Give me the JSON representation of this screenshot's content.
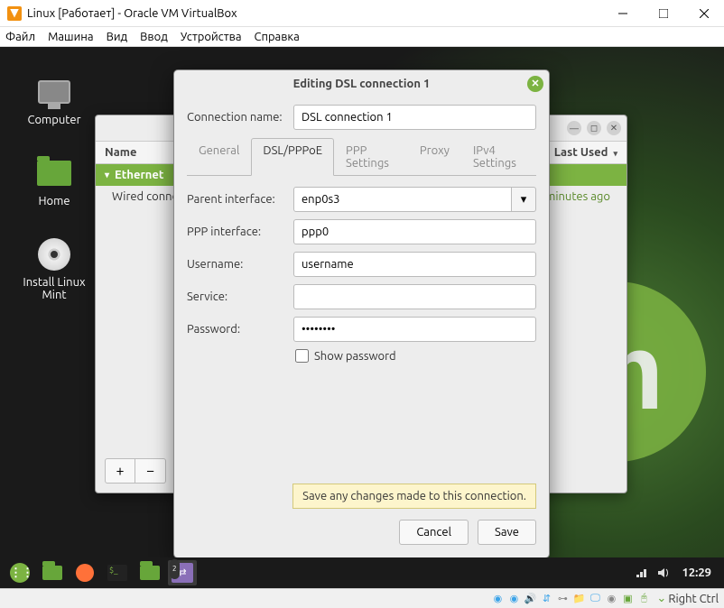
{
  "vb": {
    "title": "Linux [Работает] - Oracle VM VirtualBox",
    "menu": [
      "Файл",
      "Машина",
      "Вид",
      "Ввод",
      "Устройства",
      "Справка"
    ],
    "host_key": "Right Ctrl"
  },
  "desktop": {
    "computer": "Computer",
    "home": "Home",
    "install": "Install Linux Mint"
  },
  "panel": {
    "clock": "12:29"
  },
  "nc": {
    "col_name": "Name",
    "col_last": "Last Used",
    "section": "Ethernet",
    "row_name": "Wired connection",
    "row_last": "minutes ago",
    "add": "+",
    "remove": "−"
  },
  "dialog": {
    "title": "Editing DSL connection 1",
    "conn_name_label": "Connection name:",
    "conn_name": "DSL connection 1",
    "tabs": {
      "general": "General",
      "dsl": "DSL/PPPoE",
      "ppp": "PPP Settings",
      "proxy": "Proxy",
      "ipv4": "IPv4 Settings"
    },
    "fields": {
      "parent_label": "Parent interface:",
      "parent": "enp0s3",
      "pppif_label": "PPP interface:",
      "pppif": "ppp0",
      "user_label": "Username:",
      "user": "username",
      "service_label": "Service:",
      "service": "",
      "pass_label": "Password:",
      "pass": "••••••••",
      "showpass": "Show password"
    },
    "tooltip": "Save any changes made to this connection.",
    "cancel": "Cancel",
    "save": "Save"
  }
}
